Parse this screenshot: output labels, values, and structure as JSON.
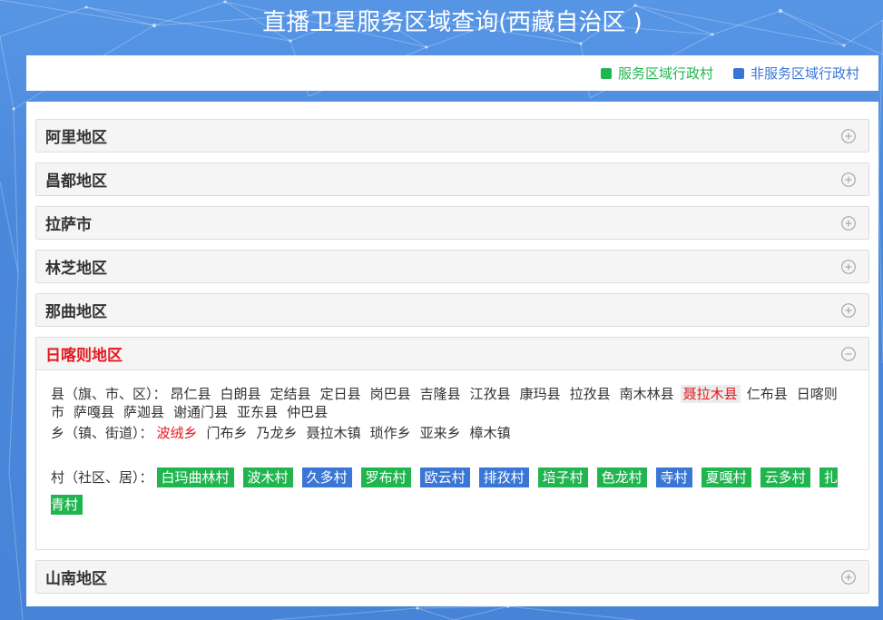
{
  "title": "直播卫星服务区域查询(西藏自治区 )",
  "legend": {
    "service_label": "服务区域行政村",
    "non_service_label": "非服务区域行政村"
  },
  "colors": {
    "page_background": "#4a88dc",
    "service": "#21b550",
    "non_service": "#3a76d6",
    "selected": "#e4181e"
  },
  "icons": {
    "collapsed": "plus-circle-icon",
    "expanded": "minus-circle-icon"
  },
  "regions": [
    {
      "name": "阿里地区",
      "expanded": false
    },
    {
      "name": "昌都地区",
      "expanded": false
    },
    {
      "name": "拉萨市",
      "expanded": false
    },
    {
      "name": "林芝地区",
      "expanded": false
    },
    {
      "name": "那曲地区",
      "expanded": false
    },
    {
      "name": "日喀则地区",
      "expanded": true,
      "details": {
        "county_label": "县（旗、市、区）：",
        "counties": [
          {
            "name": "昂仁县"
          },
          {
            "name": "白朗县"
          },
          {
            "name": "定结县"
          },
          {
            "name": "定日县"
          },
          {
            "name": "岗巴县"
          },
          {
            "name": "吉隆县"
          },
          {
            "name": "江孜县"
          },
          {
            "name": "康玛县"
          },
          {
            "name": "拉孜县"
          },
          {
            "name": "南木林县"
          },
          {
            "name": "聂拉木县",
            "selected": true
          },
          {
            "name": "仁布县"
          },
          {
            "name": "日喀则市"
          },
          {
            "name": "萨嘎县"
          },
          {
            "name": "萨迦县"
          },
          {
            "name": "谢通门县"
          },
          {
            "name": "亚东县"
          },
          {
            "name": "仲巴县"
          }
        ],
        "township_label": "乡（镇、街道）：",
        "townships": [
          {
            "name": "波绒乡",
            "selected": true
          },
          {
            "name": "门布乡"
          },
          {
            "name": "乃龙乡"
          },
          {
            "name": "聂拉木镇"
          },
          {
            "name": "琐作乡"
          },
          {
            "name": "亚来乡"
          },
          {
            "name": "樟木镇"
          }
        ],
        "village_label": "村（社区、居）：",
        "villages": [
          {
            "name": "白玛曲林村",
            "in_service": true
          },
          {
            "name": "波木村",
            "in_service": true
          },
          {
            "name": "久多村",
            "in_service": false
          },
          {
            "name": "罗布村",
            "in_service": true
          },
          {
            "name": "欧云村",
            "in_service": false
          },
          {
            "name": "排孜村",
            "in_service": false
          },
          {
            "name": "培子村",
            "in_service": true
          },
          {
            "name": "色龙村",
            "in_service": true
          },
          {
            "name": "寺村",
            "in_service": false
          },
          {
            "name": "夏嘎村",
            "in_service": true
          },
          {
            "name": "云多村",
            "in_service": true
          },
          {
            "name": "扎青村",
            "in_service": true
          }
        ]
      }
    },
    {
      "name": "山南地区",
      "expanded": false
    }
  ]
}
